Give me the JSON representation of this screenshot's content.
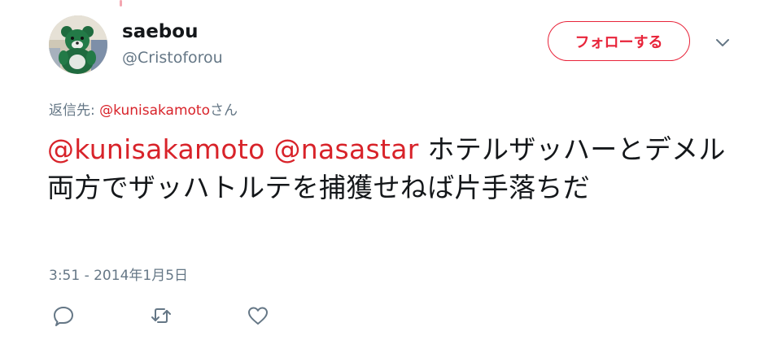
{
  "user": {
    "display_name": "saebou",
    "handle": "@Cristoforou"
  },
  "follow_button": {
    "label": "フォローする"
  },
  "reply_to": {
    "prefix": "返信先: ",
    "mention": "@kunisakamoto",
    "suffix": "さん"
  },
  "tweet": {
    "mention_1": "@kunisakamoto",
    "mention_2": "@nasastar",
    "body": " ホテルザッハーとデメル両方でザッハトルテを捕獲せねば片手落ちだ"
  },
  "timestamp": "3:51 - 2014年1月5日",
  "actions": {
    "reply_icon": "speech-bubble-icon",
    "retweet_icon": "retweet-arrows-icon",
    "like_icon": "heart-icon"
  },
  "colors": {
    "accent": "#d8232a",
    "secondary_text": "#657786",
    "icon_gray": "#657786"
  }
}
